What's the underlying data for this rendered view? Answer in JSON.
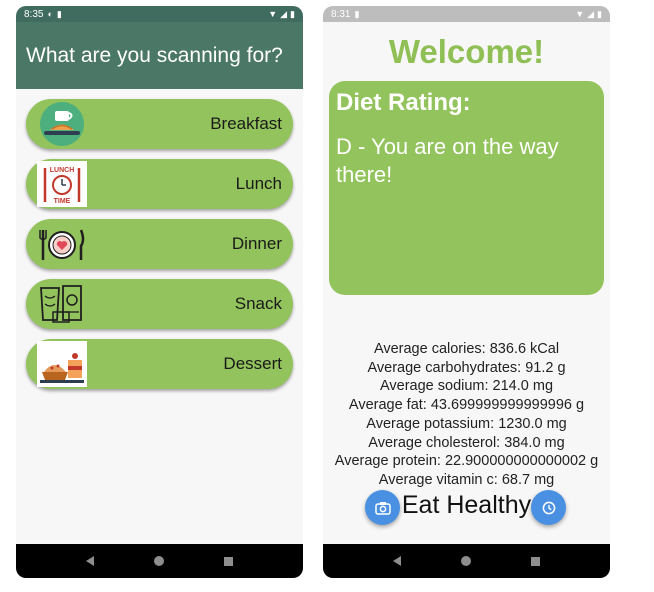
{
  "left_phone": {
    "status_bar": {
      "time": "8:35"
    },
    "app_bar": {
      "title": "What are you scanning for?"
    },
    "meal_options": [
      {
        "label": "Breakfast",
        "icon": "breakfast-icon"
      },
      {
        "label": "Lunch",
        "icon": "lunch-time-icon"
      },
      {
        "label": "Dinner",
        "icon": "dinner-plate-icon"
      },
      {
        "label": "Snack",
        "icon": "snack-icon"
      },
      {
        "label": "Dessert",
        "icon": "dessert-icon"
      }
    ],
    "lunch_icon_text": [
      "LUNCH",
      "TIME"
    ]
  },
  "right_phone": {
    "status_bar": {
      "time": "8:31"
    },
    "welcome": "Welcome!",
    "rating_card": {
      "heading": "Diet Rating:",
      "text": "D - You are on the way there!"
    },
    "stats": [
      "Average calories: 836.6 kCal",
      "Average carbohydrates: 91.2 g",
      "Average sodium: 214.0 mg",
      "Average fat: 43.699999999999996 g",
      "Average potassium: 1230.0 mg",
      "Average cholesterol: 384.0 mg",
      "Average protein: 22.900000000000002 g",
      "Average vitamin c: 68.7 mg"
    ],
    "footer_text": "Eat Healthy",
    "fab_left_icon": "camera-icon",
    "fab_right_icon": "clock-icon"
  },
  "colors": {
    "accent_green": "#93c35c",
    "app_bar": "#4b7766",
    "fab_blue": "#4a90e2",
    "welcome_green": "#8fbf55"
  }
}
